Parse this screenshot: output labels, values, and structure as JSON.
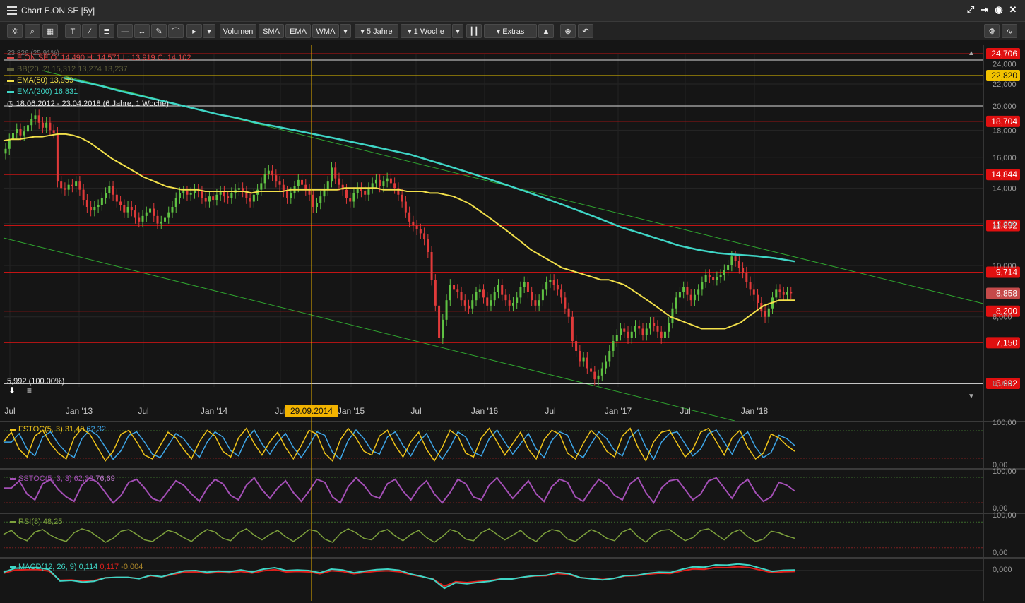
{
  "window": {
    "title": "Chart E.ON SE [5y]"
  },
  "toolbar": {
    "volumen": "Volumen",
    "sma": "SMA",
    "ema": "EMA",
    "wma": "WMA",
    "range": "5 Jahre",
    "interval": "1 Woche",
    "extras": "Extras"
  },
  "icons": [
    "menu-icon",
    "fullscreen-icon",
    "export-icon",
    "settings-icon",
    "close-icon",
    "gear-icon",
    "search-icon",
    "grid-icon",
    "text-tool-icon",
    "line-tool-icon",
    "fib-tool-icon",
    "hline-icon",
    "segment-icon",
    "brush-icon",
    "arc-icon",
    "arrow-icon",
    "chevron-down-icon",
    "candle-type-icon",
    "alarm-icon",
    "zoom-icon",
    "undo-icon",
    "layers-icon",
    "wave-icon",
    "download-icon",
    "list-icon",
    "scroll-down-icon",
    "scroll-up-icon"
  ],
  "colors": {
    "ema50": "#f2e04a",
    "ema200": "#3fd6c6",
    "trend": "#2fa52f",
    "resistance": "#d01818",
    "up": "#5fc243",
    "down": "#e03a3a",
    "fstoc": "#f0c419",
    "fstoc2": "#3ea6e8",
    "sstoc": "#a44fb6",
    "rsi": "#7da13c",
    "macd": "#3fd6c6",
    "signal": "#e0201c"
  },
  "legend": {
    "row0": "23,826 (25,91%)",
    "ohlc": "E.ON SE  O: 14,490  H: 14,571  L: 13,919  C: 14,102",
    "bb": "BB(20, 2)  15,312  13,274  13,237",
    "ema50": "EMA(50)  13,959",
    "ema200": "EMA(200)  16,831",
    "period": "18.06.2012 - 23.04.2018   (6 Jahre, 1 Woche)",
    "low": "5,992 (100.00%)"
  },
  "crosshair": {
    "date": "29.09.2014"
  },
  "indicators": {
    "fstoc": {
      "name": "FSTOC(5, 3)",
      "v1": "31,40",
      "v2": "62,32",
      "ymax": "100,00",
      "ymin": "0,00"
    },
    "sstoc": {
      "name": "SSTOC(5, 3, 3)",
      "v1": "62,32",
      "v2": "76,69",
      "ymax": "100,00",
      "ymin": "0,00"
    },
    "rsi": {
      "name": "RSI(8)",
      "v1": "48,25",
      "ymax": "100,00",
      "ymin": "0,00"
    },
    "macd": {
      "name": "MACD(12, 26, 9)",
      "v1": "0,114",
      "v2": "0,117",
      "v3": "-0,004",
      "yzero": "0,000"
    }
  },
  "chart_data": {
    "type": "candlestick",
    "yscale": "log",
    "ylim": [
      5.9,
      25.1
    ],
    "y_ticks": [
      "24,000",
      "22,000",
      "20,000",
      "18,000",
      "16,000",
      "14,000",
      "12,000",
      "10,000",
      "8,000",
      "6,000"
    ],
    "x_ticks": [
      "Jul",
      "Jan '13",
      "Jul",
      "Jan '14",
      "Jul",
      "Jan '15",
      "Jul",
      "Jan '16",
      "Jul",
      "Jan '17",
      "Jul",
      "Jan '18"
    ],
    "date_range": [
      "18.06.2012",
      "23.04.2018"
    ],
    "interval": "1 Woche",
    "closes": [
      16.6,
      17.3,
      17.8,
      18.1,
      17.6,
      17.9,
      18.4,
      18.9,
      19.2,
      18.6,
      18.2,
      18.6,
      18.0,
      17.8,
      14.4,
      14.0,
      13.9,
      14.2,
      14.1,
      14.4,
      13.9,
      13.3,
      12.9,
      12.7,
      12.9,
      13.0,
      13.4,
      13.7,
      14.1,
      13.6,
      13.2,
      13.0,
      12.6,
      12.9,
      12.7,
      12.3,
      12.1,
      12.4,
      12.6,
      12.8,
      12.4,
      12.0,
      12.1,
      12.3,
      12.6,
      12.9,
      13.4,
      13.7,
      13.8,
      13.6,
      13.7,
      13.9,
      13.8,
      13.4,
      13.2,
      13.5,
      13.3,
      13.6,
      13.8,
      13.5,
      13.4,
      13.7,
      13.9,
      14.0,
      13.8,
      13.4,
      13.2,
      13.6,
      13.9,
      14.3,
      14.9,
      15.1,
      14.8,
      14.4,
      14.2,
      13.8,
      13.4,
      13.7,
      14.1,
      14.5,
      14.2,
      13.9,
      13.6,
      12.9,
      13.1,
      13.5,
      13.9,
      14.4,
      15.3,
      14.6,
      14.2,
      13.9,
      13.4,
      13.2,
      13.7,
      14.0,
      13.8,
      13.6,
      14.0,
      14.3,
      14.5,
      14.1,
      14.4,
      14.6,
      14.3,
      14.0,
      13.6,
      13.2,
      12.6,
      12.1,
      11.9,
      11.7,
      11.5,
      11.2,
      10.6,
      9.4,
      8.4,
      7.3,
      7.9,
      8.6,
      9.2,
      9.0,
      8.9,
      8.6,
      8.4,
      8.3,
      8.6,
      8.9,
      9.0,
      8.7,
      8.4,
      8.6,
      8.9,
      9.2,
      8.8,
      8.6,
      8.4,
      8.5,
      8.7,
      9.1,
      9.3,
      8.9,
      8.6,
      8.4,
      8.6,
      9.0,
      9.3,
      9.4,
      9.2,
      9.0,
      8.7,
      8.3,
      8.0,
      7.2,
      6.9,
      6.6,
      6.7,
      6.4,
      6.3,
      6.1,
      6.2,
      6.4,
      6.6,
      6.9,
      7.2,
      7.4,
      7.6,
      7.5,
      7.3,
      7.5,
      7.7,
      7.6,
      7.4,
      7.6,
      7.8,
      7.7,
      7.5,
      7.3,
      7.5,
      7.8,
      8.3,
      8.7,
      8.9,
      9.1,
      8.8,
      8.6,
      8.8,
      9.0,
      9.3,
      9.6,
      9.5,
      9.4,
      9.5,
      9.6,
      9.8,
      10.0,
      10.4,
      10.2,
      9.9,
      9.7,
      9.3,
      9.0,
      8.8,
      8.5,
      8.2,
      8.0,
      8.3,
      8.7,
      9.0,
      8.9,
      8.8,
      8.9,
      8.86
    ],
    "ema50": [
      17.2,
      17.3,
      17.3,
      17.4,
      17.5,
      17.5,
      17.6,
      17.7,
      17.7,
      17.6,
      17.4,
      17.1,
      16.7,
      16.3,
      15.9,
      15.6,
      15.3,
      15.0,
      14.7,
      14.5,
      14.3,
      14.1,
      14.0,
      13.9,
      13.9,
      13.9,
      13.8,
      13.8,
      13.8,
      13.8,
      13.8,
      13.8,
      13.7,
      13.8,
      13.8,
      13.8,
      13.8,
      13.9,
      13.9,
      13.9,
      13.9,
      13.9,
      13.9,
      13.9,
      14.0,
      14.0,
      14.0,
      14.0,
      14.0,
      13.9,
      13.9,
      13.9,
      13.8,
      13.8,
      13.8,
      13.7,
      13.7,
      13.6,
      13.5,
      13.3,
      13.1,
      12.8,
      12.5,
      12.2,
      11.9,
      11.6,
      11.3,
      11.0,
      10.7,
      10.5,
      10.3,
      10.1,
      9.9,
      9.8,
      9.7,
      9.6,
      9.5,
      9.4,
      9.4,
      9.3,
      9.2,
      9.0,
      8.8,
      8.6,
      8.4,
      8.2,
      8.0,
      7.9,
      7.8,
      7.7,
      7.6,
      7.6,
      7.6,
      7.6,
      7.7,
      7.8,
      8.0,
      8.2,
      8.4,
      8.5,
      8.6,
      8.6,
      8.6
    ],
    "ema200": [
      22.6,
      22.2,
      21.8,
      21.3,
      20.9,
      20.5,
      20.1,
      19.7,
      19.3,
      19.0,
      18.6,
      18.3,
      18.0,
      17.7,
      17.4,
      17.1,
      16.8,
      16.5,
      16.2,
      15.8,
      15.4,
      15.0,
      14.6,
      14.2,
      13.8,
      13.4,
      13.0,
      12.6,
      12.2,
      11.8,
      11.5,
      11.2,
      10.9,
      10.7,
      10.55,
      10.48,
      10.42,
      10.32,
      10.18
    ],
    "resistance_levels": [
      24.706,
      22.82,
      18.704,
      14.844,
      11.892,
      9.714,
      8.858,
      8.2,
      7.15,
      5.992
    ],
    "resistance_labels": [
      "24,706",
      "22,820",
      "18,704",
      "14,844",
      "11,892",
      "9,714",
      "8,858",
      "8,200",
      "7,150",
      "5,992"
    ],
    "indicator_series": {
      "fstoc": [
        60,
        85,
        40,
        20,
        75,
        90,
        55,
        30,
        15,
        70,
        95,
        80,
        45,
        10,
        35,
        80,
        90,
        60,
        25,
        15,
        50,
        85,
        70,
        40,
        15,
        60,
        90,
        75,
        35,
        20,
        70,
        95,
        55,
        25,
        60,
        85,
        45,
        15,
        50,
        90,
        80,
        30,
        10,
        65,
        95,
        70,
        35,
        25,
        75,
        90,
        50,
        20,
        60,
        85,
        40,
        10,
        45,
        90,
        75,
        30,
        20,
        70,
        95,
        60,
        25,
        55,
        85,
        40,
        15,
        65,
        90,
        80,
        30,
        15,
        55,
        90,
        70,
        35,
        20,
        75,
        95,
        45,
        10,
        60,
        85,
        90,
        55,
        20,
        40,
        85,
        95,
        60,
        25,
        70,
        90,
        45,
        15,
        30,
        80,
        70,
        50,
        35
      ]
    }
  }
}
